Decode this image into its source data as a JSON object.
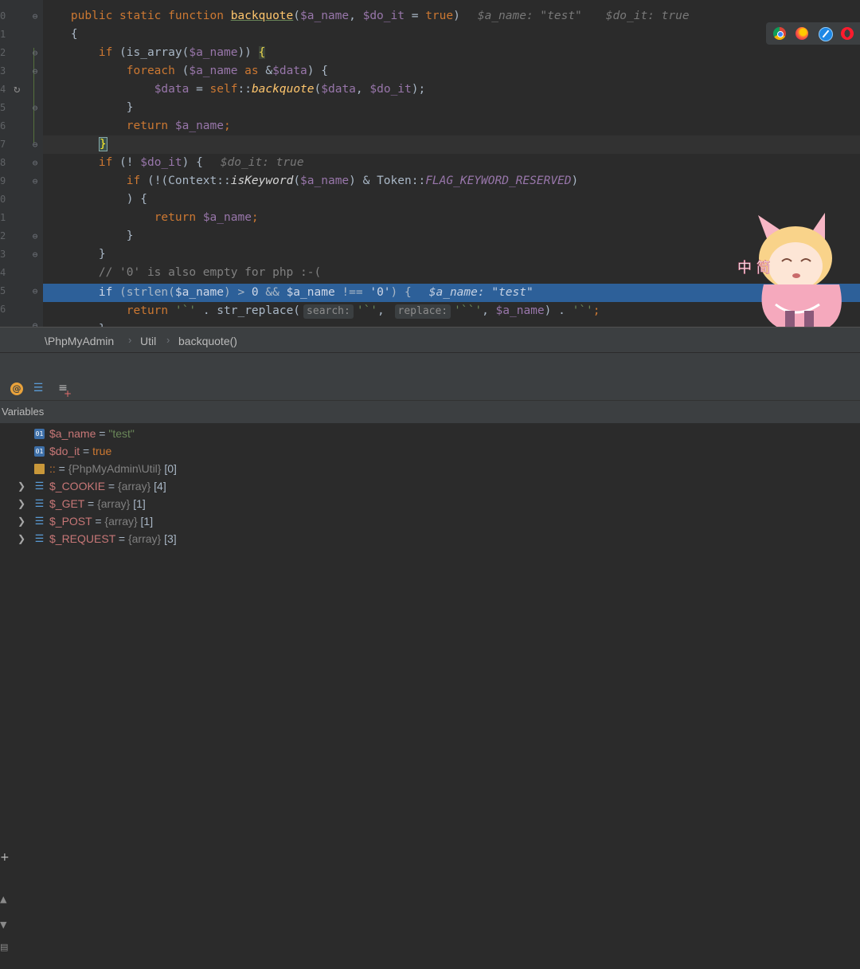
{
  "editor": {
    "gutter_numbers": [
      "0",
      "1",
      "2",
      "3",
      "4",
      "5",
      "6",
      "7",
      "8",
      "9",
      "0",
      "1",
      "2",
      "3",
      "4",
      "5",
      "6"
    ],
    "lines": {
      "l0_pre": "    public static function ",
      "l0_fn": "backquote",
      "l0_args_open": "(",
      "l0_arg1": "$a_name",
      "l0_comma": ", ",
      "l0_arg2": "$do_it",
      "l0_eq": " = ",
      "l0_true": "true",
      "l0_close": ")",
      "l0_hint1": "$a_name: \"test\"",
      "l0_hint2": "$do_it: true",
      "l1": "    {",
      "l2_kw": "if",
      "l2_a": " (is_array(",
      "l2_var": "$a_name",
      "l2_b": ")) ",
      "l2_brace": "{",
      "l3_kw": "foreach",
      "l3_a": " (",
      "l3_var": "$a_name",
      "l3_as": " as ",
      "l3_b": "&",
      "l3_var2": "$data",
      "l3_c": ") {",
      "l4_var": "$data",
      "l4_a": " = ",
      "l4_self": "self",
      "l4_b": "::",
      "l4_fn": "backquote",
      "l4_c": "(",
      "l4_var2": "$data",
      "l4_d": ", ",
      "l4_var3": "$do_it",
      "l4_e": ");",
      "l5": "}",
      "l6_kw": "return",
      "l6_sp": " ",
      "l6_var": "$a_name",
      "l6_semi": ";",
      "l7_brace": "}",
      "l8_kw": "if",
      "l8_a": " (! ",
      "l8_var": "$do_it",
      "l8_b": ") {",
      "l8_hint": "$do_it: true",
      "l9_kw": "if",
      "l9_a": " (!(Context::",
      "l9_fn": "isKeyword",
      "l9_b": "(",
      "l9_var": "$a_name",
      "l9_c": ") & Token::",
      "l9_const": "FLAG_KEYWORD_RESERVED",
      "l9_d": ")",
      "l10": ") {",
      "l11_kw": "return",
      "l11_sp": " ",
      "l11_var": "$a_name",
      "l11_semi": ";",
      "l12": "}",
      "l13": "}",
      "l14_comment": "// '0' is also empty for php :-(",
      "l15_kw": "if",
      "l15_a": " (strlen(",
      "l15_var": "$a_name",
      "l15_b": ") > ",
      "l15_num": "0",
      "l15_c": " && ",
      "l15_var2": "$a_name",
      "l15_d": " !== ",
      "l15_str": "'0'",
      "l15_e": ") {",
      "l15_hint": "$a_name: \"test\"",
      "l16_kw": "return",
      "l16_a": " ",
      "l16_str1": "'`'",
      "l16_b": " . str_replace(",
      "l16_ph1": "search:",
      "l16_str2": "'`'",
      "l16_c": ", ",
      "l16_ph2": "replace:",
      "l16_str3": "'``'",
      "l16_d": ", ",
      "l16_var": "$a_name",
      "l16_e": ") . ",
      "l16_str4": "'`'",
      "l16_f": ";",
      "l17": "}"
    }
  },
  "browsers": [
    "chrome-icon",
    "firefox-icon",
    "safari-icon",
    "opera-icon"
  ],
  "breadcrumb": {
    "items": [
      "\\PhpMyAdmin",
      "Util",
      "backquote()"
    ],
    "sep": "›"
  },
  "debugger": {
    "panel_title": "Variables",
    "variables": [
      {
        "name": "$a_name",
        "eq": " = ",
        "value": "\"test\"",
        "icon": "01",
        "value_type": "string",
        "expandable": false
      },
      {
        "name": "$do_it",
        "eq": " = ",
        "value": "true",
        "icon": "01",
        "value_type": "bool",
        "expandable": false
      },
      {
        "name": "::",
        "eq": " = ",
        "type": "{PhpMyAdmin\\Util}",
        "count": "[0]",
        "icon": "obj",
        "expandable": false
      },
      {
        "name": "$_COOKIE",
        "eq": " = ",
        "type": "{array}",
        "count": "[4]",
        "icon": "arr",
        "expandable": true
      },
      {
        "name": "$_GET",
        "eq": " = ",
        "type": "{array}",
        "count": "[1]",
        "icon": "arr",
        "expandable": true
      },
      {
        "name": "$_POST",
        "eq": " = ",
        "type": "{array}",
        "count": "[1]",
        "icon": "arr",
        "expandable": true
      },
      {
        "name": "$_REQUEST",
        "eq": " = ",
        "type": "{array}",
        "count": "[3]",
        "icon": "arr",
        "expandable": true
      }
    ]
  },
  "mascot_text": "中 简",
  "colors": {
    "exec_line": "#2d6099",
    "bg": "#2b2b2b",
    "panel": "#3c3f41"
  }
}
